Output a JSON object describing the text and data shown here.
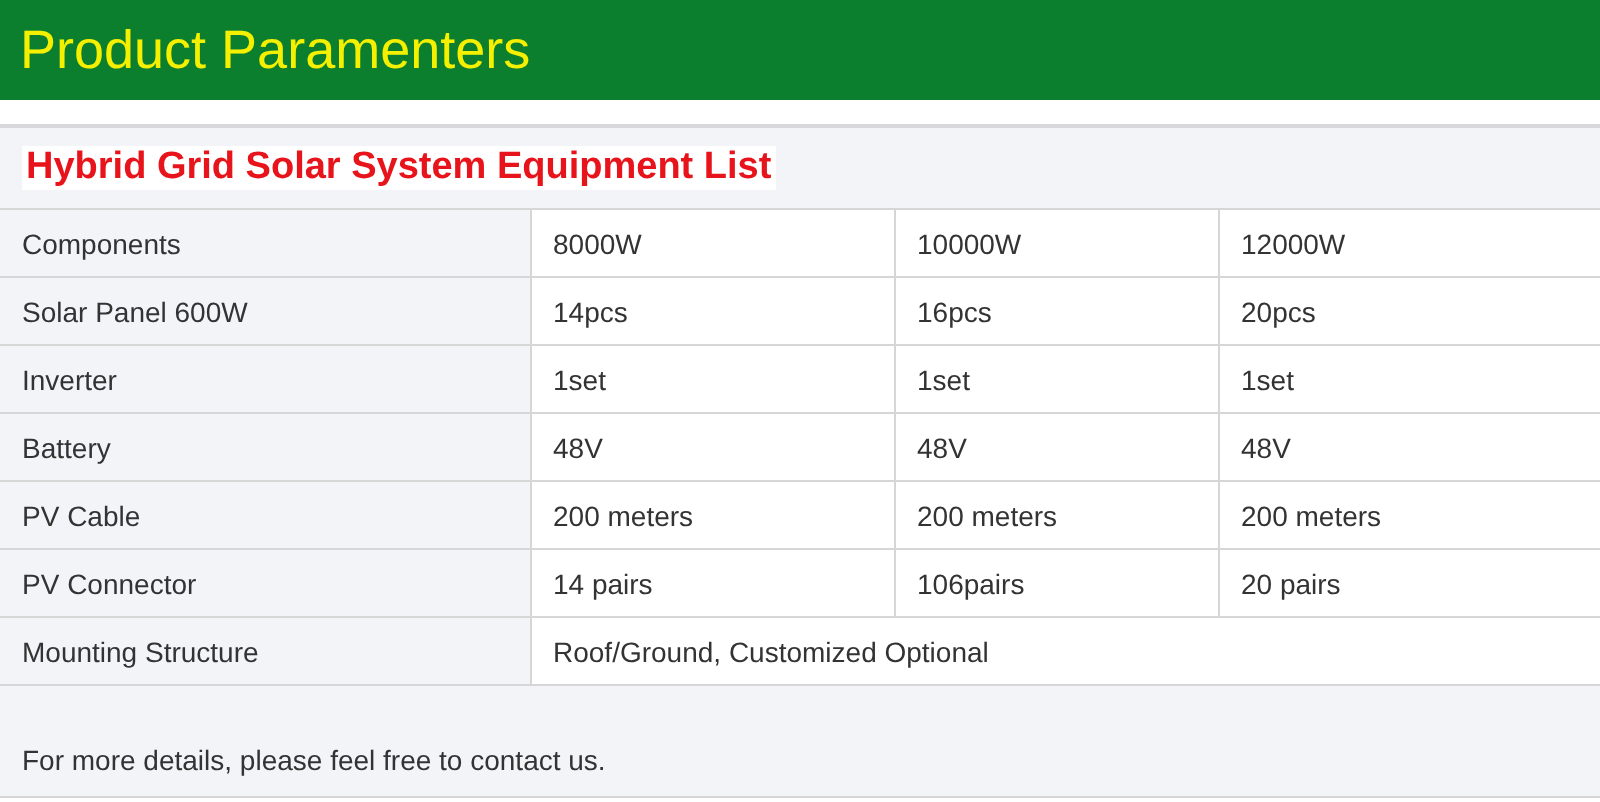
{
  "header": {
    "title": "Product Paramenters"
  },
  "table": {
    "title": "Hybrid Grid Solar System Equipment List",
    "rows": [
      {
        "label": "Components",
        "values": [
          "8000W",
          "10000W",
          "12000W"
        ]
      },
      {
        "label": "Solar Panel 600W",
        "values": [
          "14pcs",
          "16pcs",
          "20pcs"
        ]
      },
      {
        "label": "Inverter",
        "values": [
          "1set",
          "1set",
          "1set"
        ]
      },
      {
        "label": "Battery",
        "values": [
          "48V",
          "48V",
          "48V"
        ]
      },
      {
        "label": "PV Cable",
        "values": [
          "200 meters",
          "200 meters",
          "200 meters"
        ]
      },
      {
        "label": "PV Connector",
        "values": [
          "14 pairs",
          "106pairs",
          "20 pairs"
        ]
      },
      {
        "label": "Mounting Structure",
        "values": [
          "Roof/Ground, Customized Optional"
        ]
      }
    ]
  },
  "footer": {
    "text": "For more details, please feel free to contact us."
  }
}
